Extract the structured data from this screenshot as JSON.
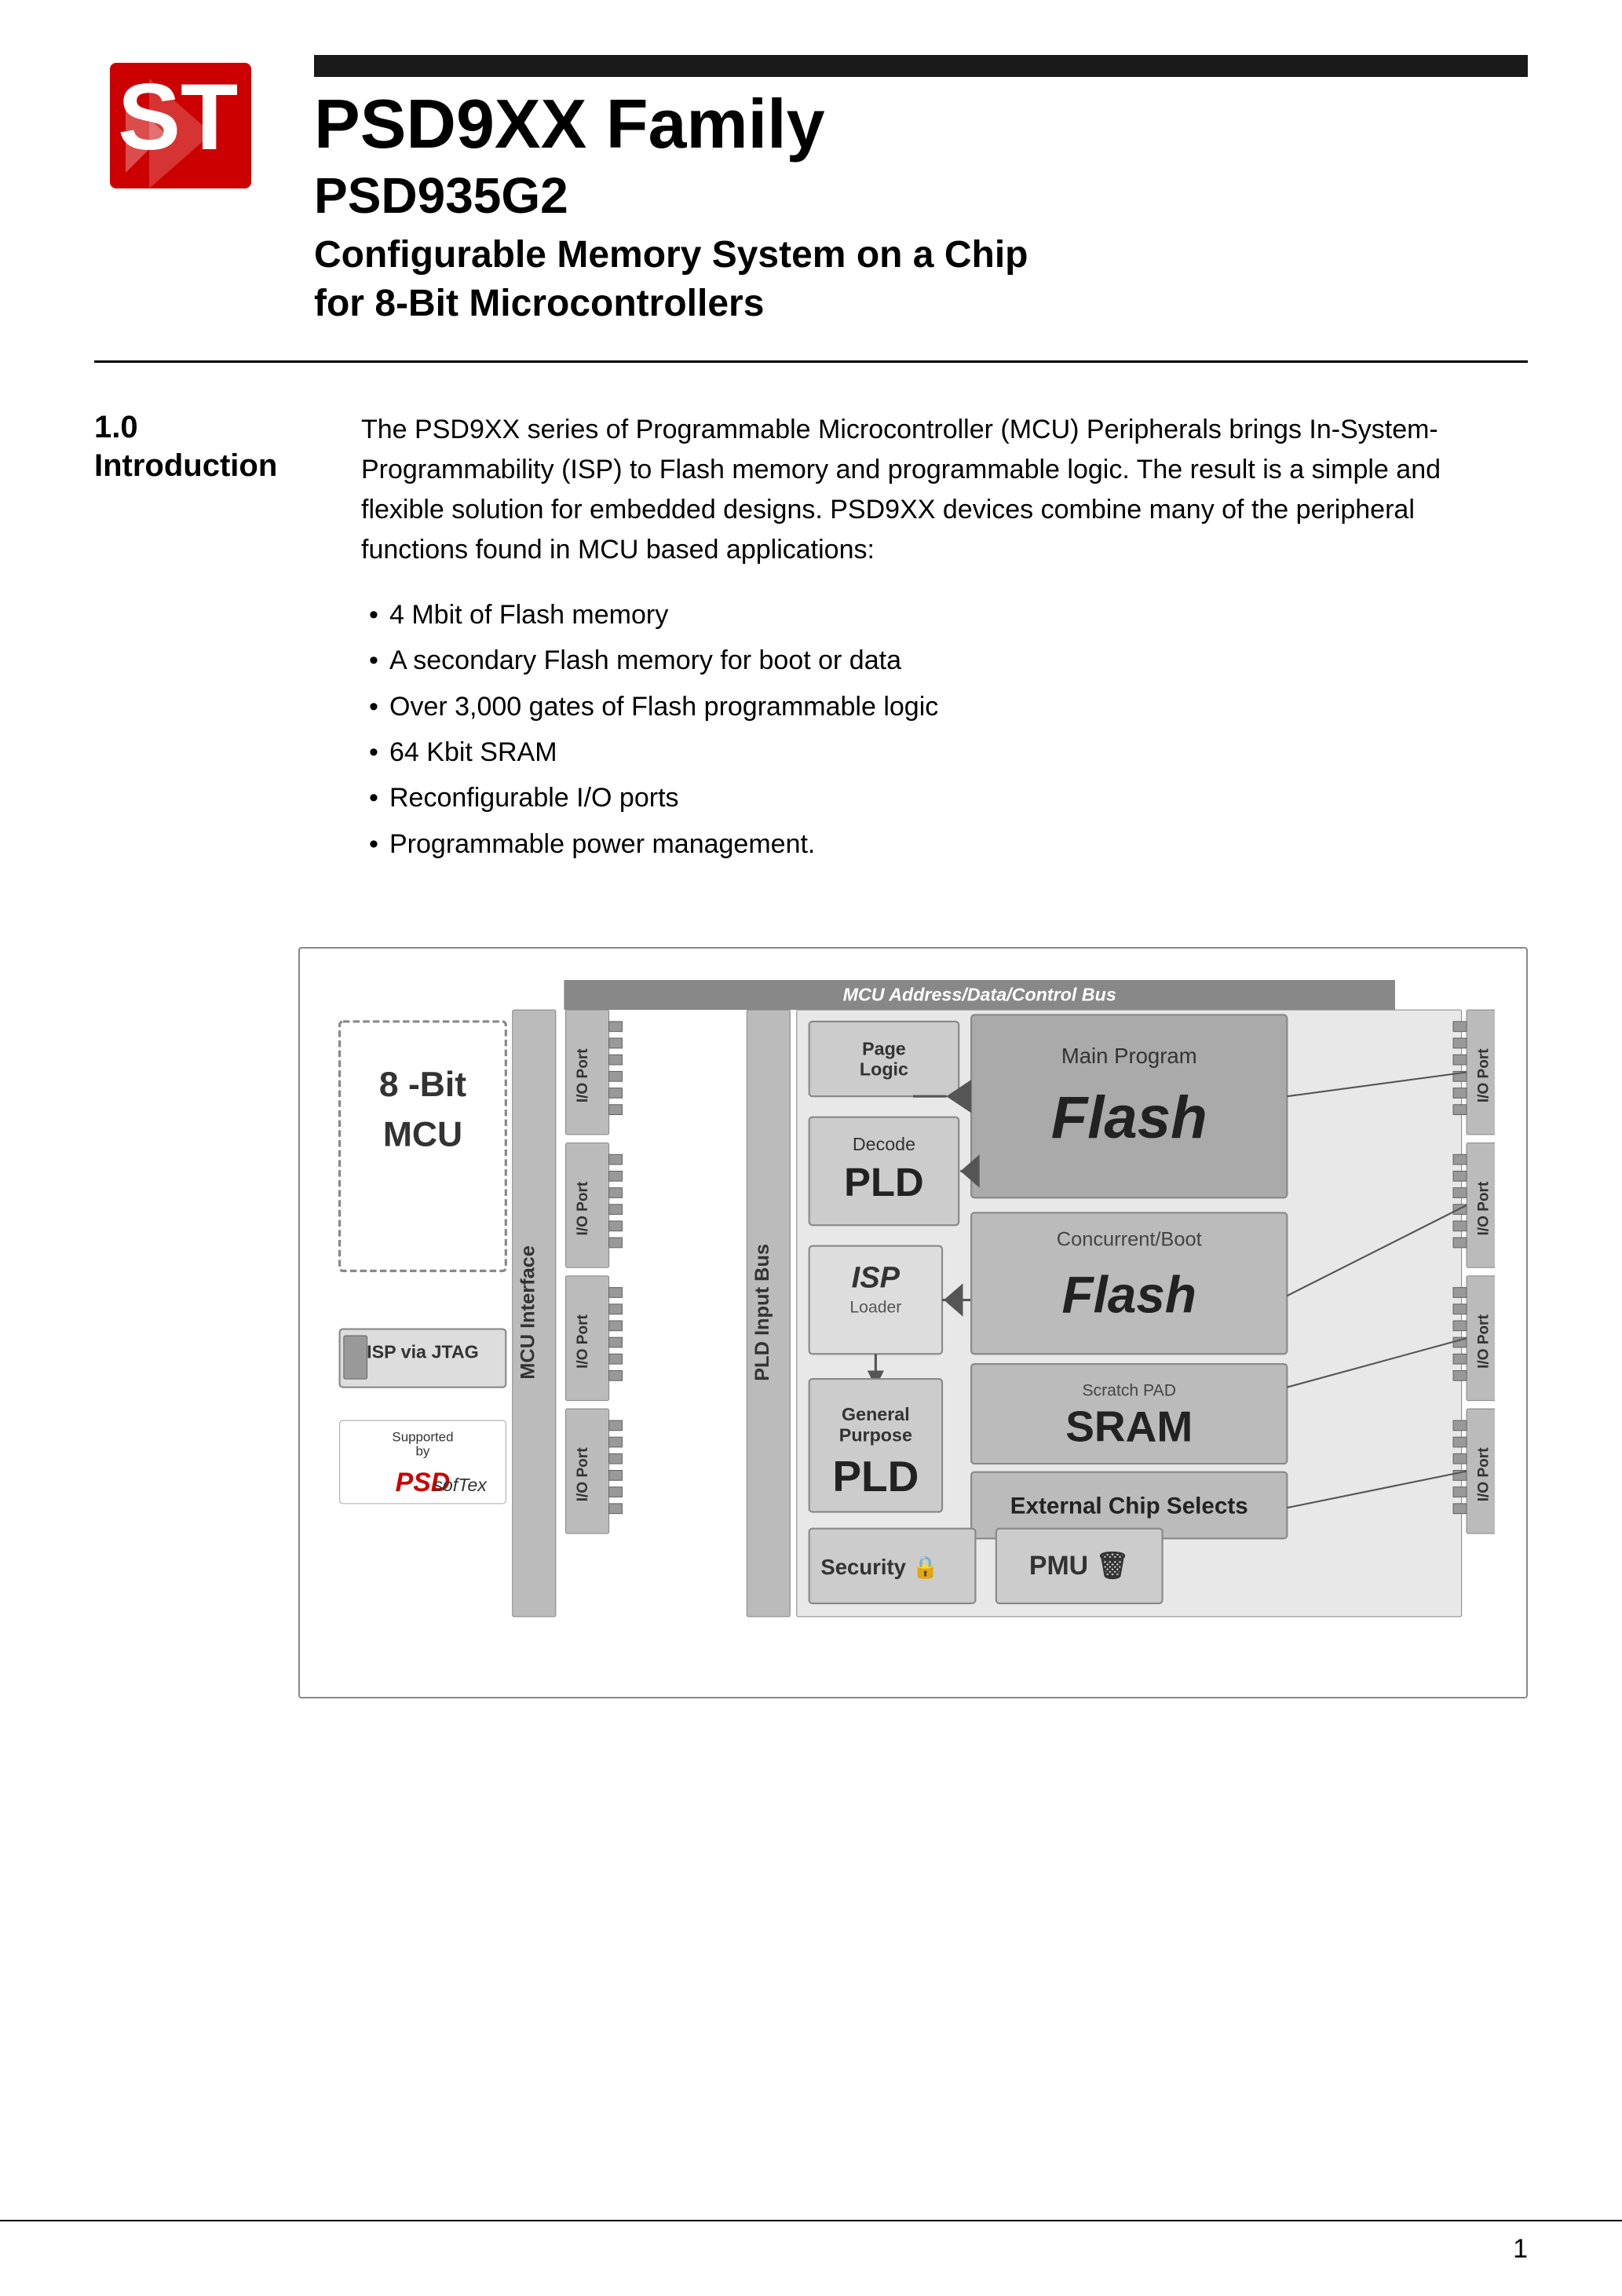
{
  "header": {
    "bar_color": "#1a1a1a",
    "product_family": "PSD9XX Family",
    "product_model": "PSD935G2",
    "product_desc_line1": "Configurable Memory System on a Chip",
    "product_desc_line2": "for 8-Bit Microcontrollers"
  },
  "section": {
    "number": "1.0",
    "title": "Introduction"
  },
  "intro": {
    "text": "The PSD9XX series of Programmable Microcontroller (MCU) Peripherals brings In-System-Programmability (ISP) to Flash memory and programmable logic. The result is a simple and flexible solution for embedded designs. PSD9XX devices combine many of the peripheral functions found in MCU based applications:",
    "bullets": [
      "4 Mbit of Flash memory",
      "A secondary Flash memory for boot or data",
      "Over 3,000 gates of Flash programmable logic",
      "64 Kbit SRAM",
      "Reconfigurable I/O ports",
      "Programmable power management."
    ]
  },
  "diagram": {
    "title": "MCU Address/Data/Control Bus",
    "blocks": {
      "mcu": "8-Bit\nMCU",
      "mcu_interface": "MCU Interface",
      "page_logic": "Page Logic",
      "main_program_label": "Main Program",
      "main_program_flash": "Flash",
      "decode": "Decode",
      "pld_decode": "PLD",
      "concurrent_boot": "Concurrent/Boot",
      "concurrent_flash": "Flash",
      "isp_via_jtag": "ISP via JTAG",
      "isp_loader": "ISP",
      "isp_loader_sub": "Loader",
      "scratch_pad": "Scratch PAD",
      "sram": "SRAM",
      "io_port_left_top": "I/O Port",
      "io_port_left_mid": "I/O Port",
      "io_port_left_bot": "I/O Port",
      "general_purpose": "General\nPurpose",
      "pld_gp": "PLD",
      "external_chip_selects": "External Chip Selects",
      "pld_input_bus": "PLD Input Bus",
      "security": "Security",
      "pmu": "PMU",
      "io_port_right_top": "I/O Port",
      "io_port_right_mid1": "I/O Port",
      "io_port_right_mid2": "I/O Port",
      "io_port_right_bot": "I/O Port",
      "io_port_left_bottom2": "I/O Port",
      "supported_by": "Supported\nby"
    }
  },
  "footer": {
    "page_number": "1"
  }
}
